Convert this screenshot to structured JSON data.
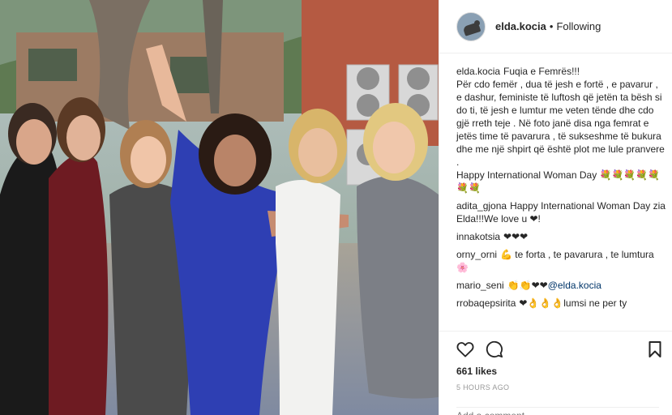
{
  "post": {
    "image_alt": "Group photo of six women outdoors",
    "username": "elda.kocia",
    "separator": "•",
    "follow_status": "Following",
    "caption": {
      "username": "elda.kocia",
      "text": "Fuqia e Femrës!!!\nPër cdo femër , dua të jesh e fortë , e pavarur , e dashur, feministe të luftosh që jetën ta bësh si do ti, të jesh e lumtur me veten tënde dhe cdo gjë rreth teje . Në foto janë disa nga femrat e jetës time të pavarura , të sukseshme të bukura dhe me një shpirt që është plot me lule pranvere .\nHappy International Woman Day 💐💐💐💐💐💐💐"
    },
    "comments": [
      {
        "username": "adita_gjona",
        "text": "Happy International Woman Day zia Elda!!!We love u ❤!"
      },
      {
        "username": "innakotsia",
        "text": "❤❤❤"
      },
      {
        "username": "orny_orni",
        "text": "💪 te forta , te pavarura , te lumtura 🌸"
      },
      {
        "username": "mario_seni",
        "text": "👏👏❤❤",
        "mention": "@elda.kocia"
      },
      {
        "username": "rrobaqepsirita",
        "text": "❤👌👌👌lumsi ne per ty"
      }
    ],
    "likes": "661 likes",
    "time": "5 HOURS AGO",
    "add_comment_placeholder": "Add a comment..."
  },
  "icons": {
    "like": "heart-icon",
    "comment": "speech-bubble-icon",
    "save": "bookmark-icon"
  }
}
